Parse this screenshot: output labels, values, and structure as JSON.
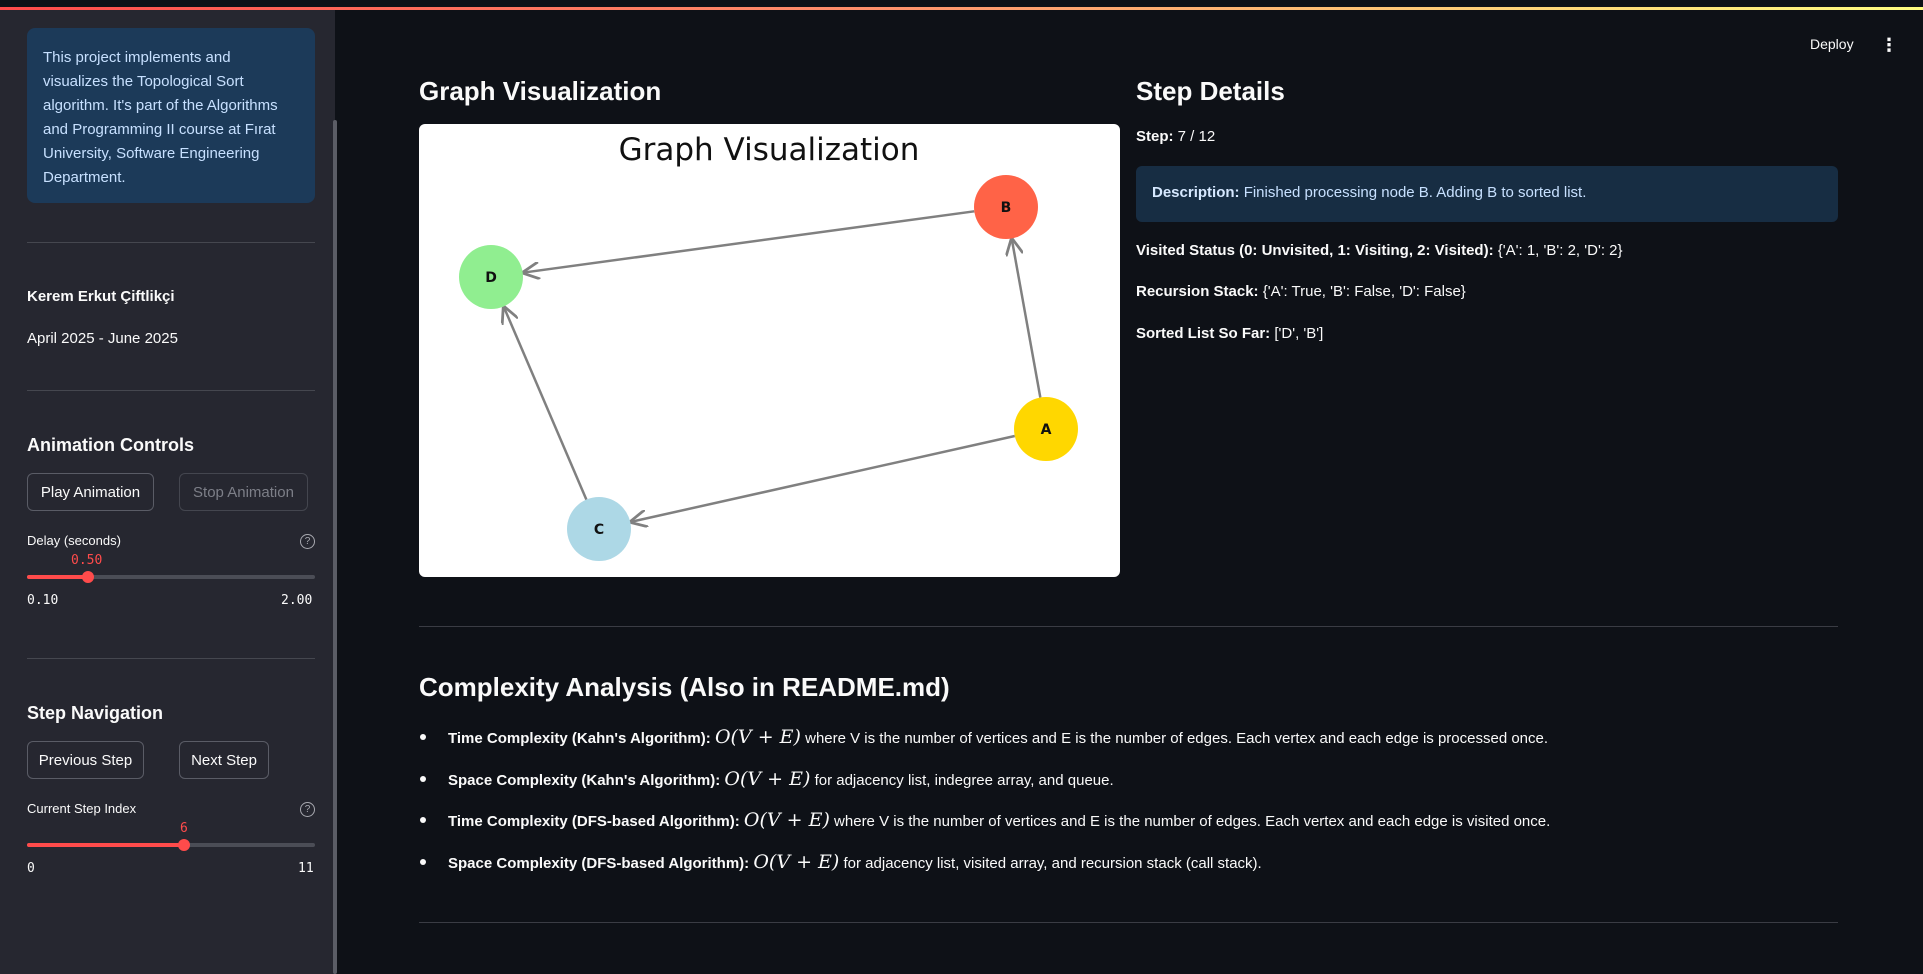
{
  "sidebar": {
    "about_text": "This project implements and visualizes the Topological Sort algorithm. It's part of the Algorithms and Programming II course at Fırat University, Software Engineering Department.",
    "author": "Kerem Erkut Çiftlikçi",
    "dates": "April 2025 - June 2025",
    "animation_controls": {
      "title": "Animation Controls",
      "play_label": "Play Animation",
      "stop_label": "Stop Animation",
      "delay_label": "Delay (seconds)",
      "delay_value": "0.50",
      "delay_min": "0.10",
      "delay_max": "2.00",
      "delay_fraction": 0.2105
    },
    "step_navigation": {
      "title": "Step Navigation",
      "prev_label": "Previous Step",
      "next_label": "Next Step",
      "index_label": "Current Step Index",
      "index_value": "6",
      "index_min": "0",
      "index_max": "11",
      "index_fraction": 0.5455
    }
  },
  "header": {
    "deploy_label": "Deploy",
    "menu_icon": "kebab-menu-icon"
  },
  "graph": {
    "section_title": "Graph Visualization",
    "figure_title": "Graph Visualization",
    "nodes": [
      {
        "id": "A",
        "color": "#ffd700"
      },
      {
        "id": "B",
        "color": "#ff6347"
      },
      {
        "id": "C",
        "color": "#add8e6"
      },
      {
        "id": "D",
        "color": "#90ee90"
      }
    ],
    "edges": [
      [
        "A",
        "B"
      ],
      [
        "A",
        "C"
      ],
      [
        "B",
        "D"
      ],
      [
        "C",
        "D"
      ]
    ]
  },
  "step_details": {
    "title": "Step Details",
    "step_label": "Step:",
    "step_value": "7 / 12",
    "description_label": "Description:",
    "description_value": "Finished processing node B. Adding B to sorted list.",
    "visited_label": "Visited Status (0: Unvisited, 1: Visiting, 2: Visited):",
    "visited_value": "{'A': 1, 'B': 2, 'D': 2}",
    "stack_label": "Recursion Stack:",
    "stack_value": "{'A': True, 'B': False, 'D': False}",
    "sorted_label": "Sorted List So Far:",
    "sorted_value": "['D', 'B']"
  },
  "complexity": {
    "title": "Complexity Analysis (Also in README.md)",
    "items": [
      {
        "label": "Time Complexity (Kahn's Algorithm):",
        "math": "O(V + E)",
        "text": "where V is the number of vertices and E is the number of edges. Each vertex and each edge is processed once."
      },
      {
        "label": "Space Complexity (Kahn's Algorithm):",
        "math": "O(V + E)",
        "text": "for adjacency list, indegree array, and queue."
      },
      {
        "label": "Time Complexity (DFS-based Algorithm):",
        "math": "O(V + E)",
        "text": "where V is the number of vertices and E is the number of edges. Each vertex and each edge is visited once."
      },
      {
        "label": "Space Complexity (DFS-based Algorithm):",
        "math": "O(V + E)",
        "text": "for adjacency list, visited array, and recursion stack (call stack)."
      }
    ]
  }
}
